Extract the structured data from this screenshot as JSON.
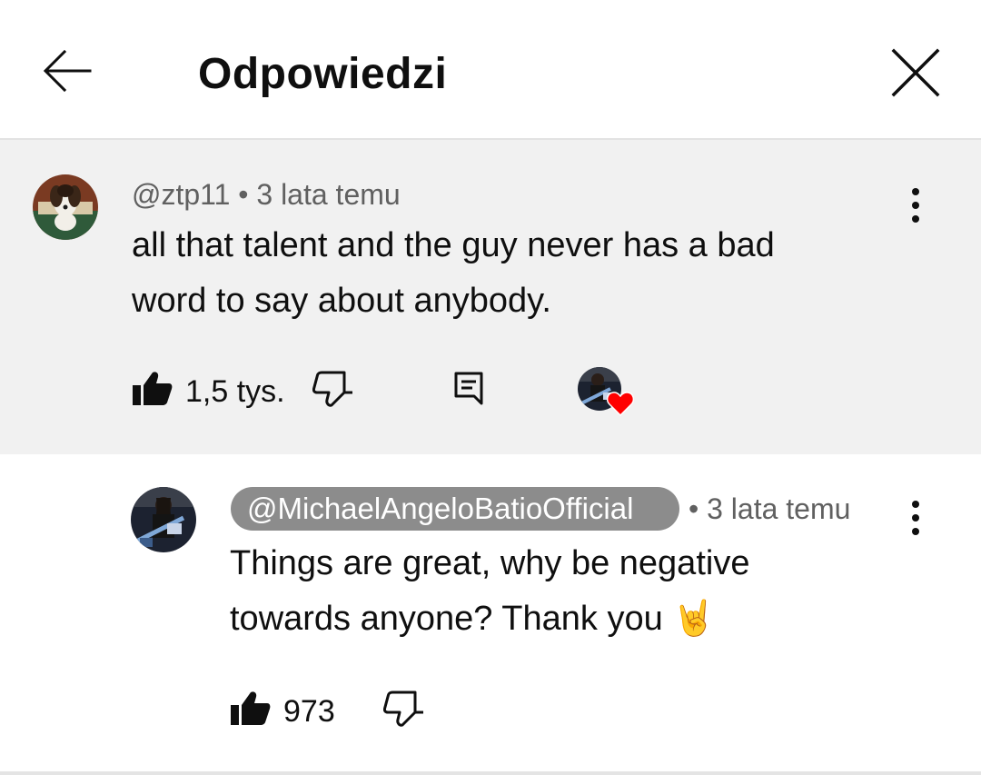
{
  "header": {
    "title": "Odpowiedzi",
    "back_icon": "arrow-left-icon",
    "close_icon": "close-icon"
  },
  "parent_comment": {
    "author": "@ztp11",
    "separator": " • ",
    "time": "3 lata temu",
    "text_line1": "all that talent and the guy never has a bad",
    "text_line2": "word to say about anybody.",
    "likes": "1,5 tys.",
    "heart_color": "#ff0000"
  },
  "reply": {
    "author": "@MichaelAngeloBatioOfficial",
    "separator": "•",
    "time": "3 lata temu",
    "text_line1": "Things are great, why be negative",
    "text_line2": "towards anyone? Thank you",
    "emoji": "🤘",
    "likes": "973"
  }
}
